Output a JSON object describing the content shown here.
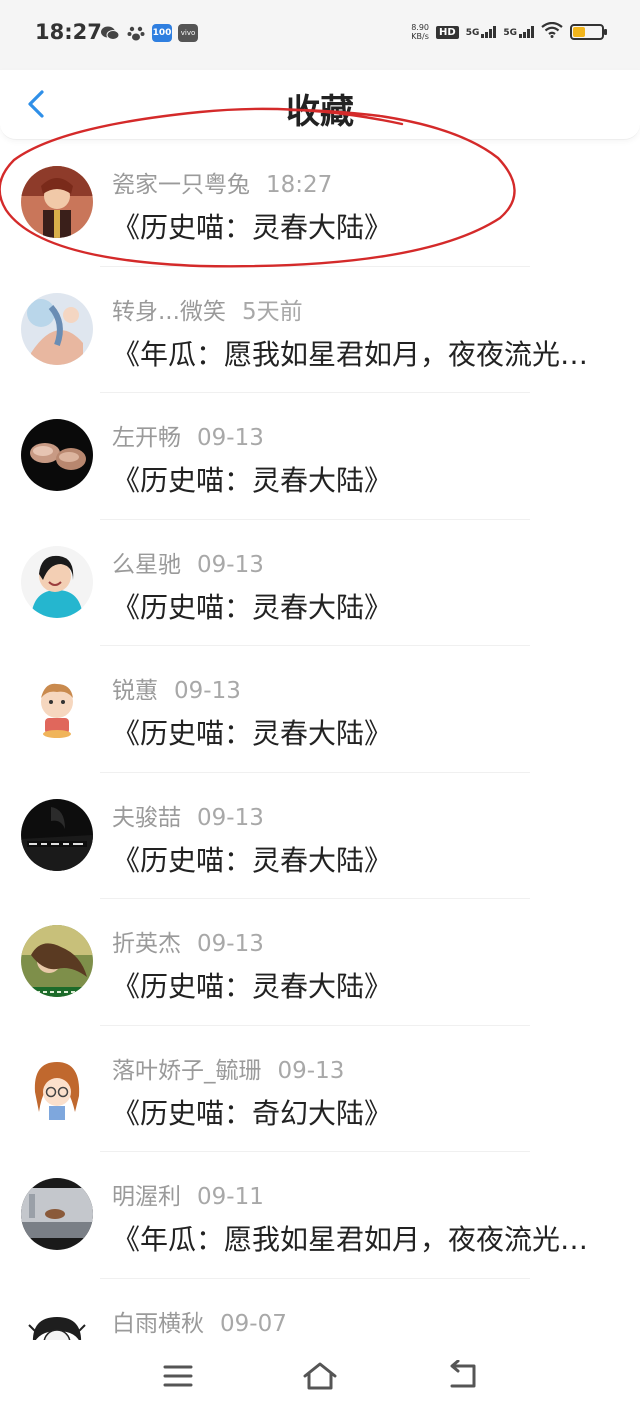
{
  "status_bar": {
    "time": "18:27",
    "net_speed_value": "8.90",
    "net_speed_unit": "KB/s",
    "hd_label": "HD",
    "sim1_label": "5G",
    "sim2_label": "5G",
    "app_badge_label": "100"
  },
  "header": {
    "title": "收藏"
  },
  "favorites": [
    {
      "name": "瓷家一只粤兔",
      "time": "18:27",
      "message": "《历史喵：灵春大陆》"
    },
    {
      "name": "转身...微笑",
      "time": "5天前",
      "message": "《年瓜：愿我如星君如月，夜夜流光…"
    },
    {
      "name": "左开畅",
      "time": "09-13",
      "message": "《历史喵：灵春大陆》"
    },
    {
      "name": "么星驰",
      "time": "09-13",
      "message": "《历史喵：灵春大陆》"
    },
    {
      "name": "锐蕙",
      "time": "09-13",
      "message": "《历史喵：灵春大陆》"
    },
    {
      "name": "夫骏喆",
      "time": "09-13",
      "message": "《历史喵：灵春大陆》"
    },
    {
      "name": "折英杰",
      "time": "09-13",
      "message": "《历史喵：灵春大陆》"
    },
    {
      "name": "落叶娇子_毓珊",
      "time": "09-13",
      "message": "《历史喵：奇幻大陆》"
    },
    {
      "name": "明渥利",
      "time": "09-11",
      "message": "《年瓜：愿我如星君如月，夜夜流光…"
    },
    {
      "name": "白雨横秋",
      "time": "09-07",
      "message": ""
    }
  ],
  "colors": {
    "accent": "#2f8fe8",
    "annotation": "#d42a2a"
  },
  "nav": {
    "menu_icon": "menu-icon",
    "home_icon": "home-icon",
    "back_icon": "return-icon"
  }
}
